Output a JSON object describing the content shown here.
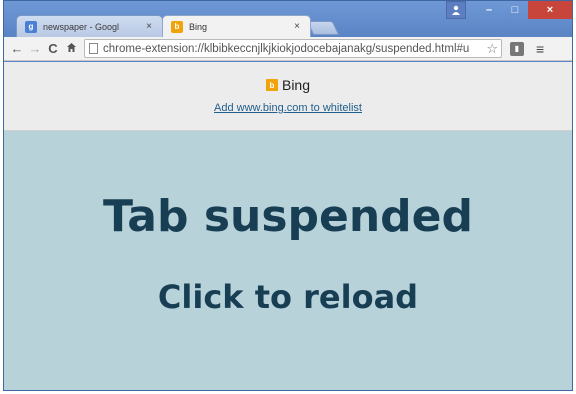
{
  "browser": {
    "tabs": [
      {
        "title": "newspaper - Googl",
        "favicon": "google-icon",
        "close": "×",
        "active": false
      },
      {
        "title": "Bing",
        "favicon": "bing-icon",
        "close": "×",
        "active": true
      }
    ],
    "window_controls": {
      "user": "user-icon",
      "minimize": "–",
      "maximize": "□",
      "close": "×"
    },
    "toolbar": {
      "back": "←",
      "forward": "→",
      "reload": "C",
      "home": "🏠",
      "url": "chrome-extension://klbibkeccnjlkjkiokjodocebajanakg/suspended.html#u",
      "bookmark_star": "☆",
      "menu": "≡"
    }
  },
  "page": {
    "site_name": "Bing",
    "whitelist_link": "Add www.bing.com to whitelist",
    "title": "Tab suspended",
    "subtitle": "Click to reload"
  },
  "colors": {
    "suspended_bg": "#b8d2da",
    "text_dark": "#183e54",
    "link": "#215f8c",
    "bing_brand": "#f0a30a",
    "close_button": "#c7453a"
  }
}
